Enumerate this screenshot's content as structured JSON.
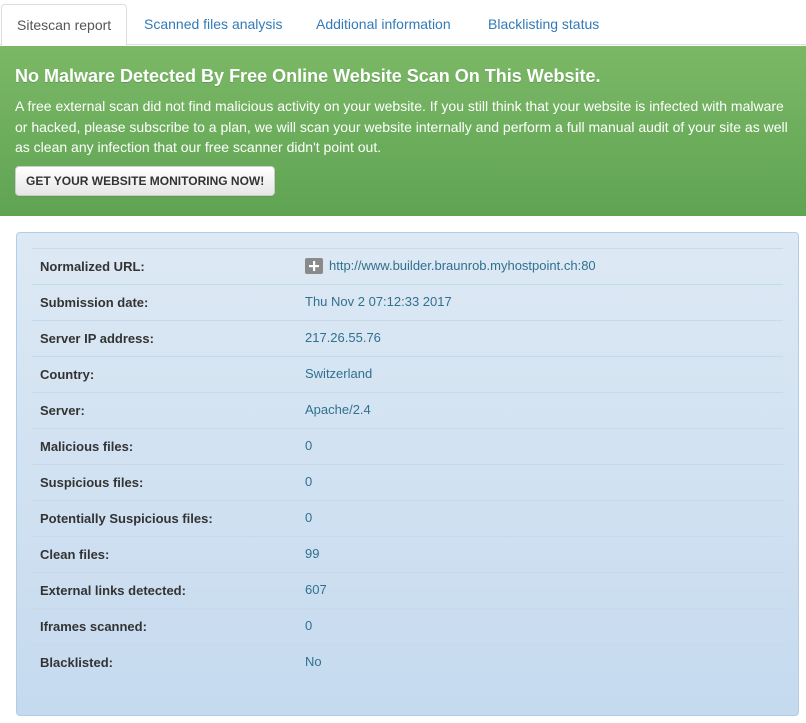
{
  "tabs": [
    {
      "label": "Sitescan report",
      "active": true
    },
    {
      "label": "Scanned files analysis",
      "active": false
    },
    {
      "label": "Additional information",
      "active": false
    },
    {
      "label": "Blacklisting status",
      "active": false
    }
  ],
  "banner": {
    "title": "No Malware Detected By Free Online Website Scan On This Website.",
    "text": "A free external scan did not find malicious activity on your website. If you still think that your website is infected with malware or hacked, please subscribe to a plan, we will scan your website internally and perform a full manual audit of your site as well as clean any infection that our free scanner didn't point out.",
    "button_label": "GET YOUR WEBSITE MONITORING NOW!",
    "color": "#6aad5c"
  },
  "report": {
    "url_icon": "plus-icon",
    "rows": [
      {
        "label": "Normalized URL:",
        "value": "http://www.builder.braunrob.myhostpoint.ch:80"
      },
      {
        "label": "Submission date:",
        "value": "Thu Nov 2 07:12:33 2017"
      },
      {
        "label": "Server IP address:",
        "value": "217.26.55.76"
      },
      {
        "label": "Country:",
        "value": "Switzerland"
      },
      {
        "label": "Server:",
        "value": "Apache/2.4"
      },
      {
        "label": "Malicious files:",
        "value": "0"
      },
      {
        "label": "Suspicious files:",
        "value": "0"
      },
      {
        "label": "Potentially Suspicious files:",
        "value": "0"
      },
      {
        "label": "Clean files:",
        "value": "99"
      },
      {
        "label": "External links detected:",
        "value": "607"
      },
      {
        "label": "Iframes scanned:",
        "value": "0"
      },
      {
        "label": "Blacklisted:",
        "value": "No"
      }
    ]
  }
}
